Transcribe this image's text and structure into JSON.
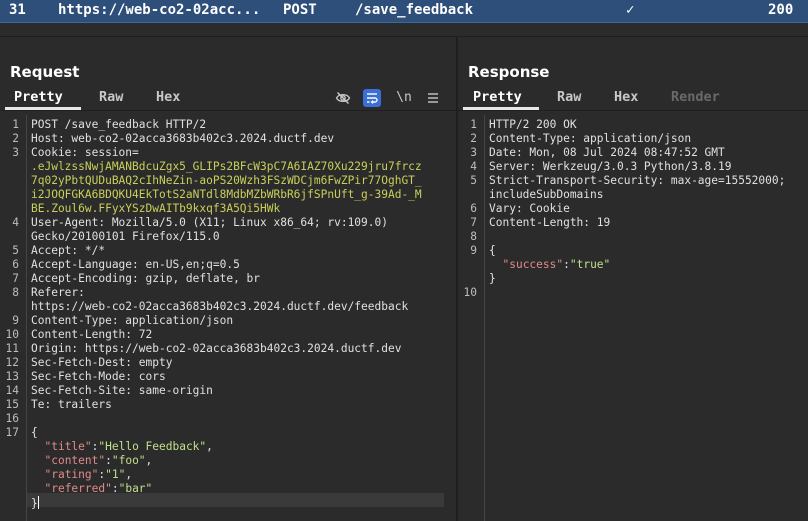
{
  "selected_row": {
    "id": "31",
    "url": "https://web-co2-02acc...",
    "method": "POST",
    "path": "/save_feedback",
    "check": "✓",
    "status": "200"
  },
  "request": {
    "title": "Request",
    "tabs": [
      "Pretty",
      "Raw",
      "Hex"
    ],
    "active_tab": "Pretty",
    "toolbar_icons": [
      "eye-slash-icon",
      "wrap-icon",
      "newline-icon",
      "menu-icon"
    ],
    "newline_label": "\\n",
    "lines": [
      {
        "n": "1",
        "text": "POST /save_feedback HTTP/2"
      },
      {
        "n": "2",
        "text": "Host: web-co2-02acca3683b402c3.2024.ductf.dev"
      },
      {
        "n": "3",
        "text": "Cookie: session="
      },
      {
        "n": "",
        "text": ".eJwlzssNwjAMANBdcuZgx5_GLIPs2BFcW3pC7A6IAZ70Xu229jru7frcz"
      },
      {
        "n": "",
        "text": "7q02yPbtQUDuBAQ2cIhNeZin-aoPS20Wzh3FSzWDCjm6FwZPir77OghGT_"
      },
      {
        "n": "",
        "text": "i2JOQFGKA6BDQKU4EkTotS2aNTdl8MdbMZbWRbR6jfSPnUft_g-39Ad-_M"
      },
      {
        "n": "",
        "text": "BE.Zoul6w.FFyxYSzDwAITb9kxqf3A5Qi5HWk"
      },
      {
        "n": "4",
        "text": "User-Agent: Mozilla/5.0 (X11; Linux x86_64; rv:109.0)"
      },
      {
        "n": "",
        "text": "Gecko/20100101 Firefox/115.0"
      },
      {
        "n": "5",
        "text": "Accept: */*"
      },
      {
        "n": "6",
        "text": "Accept-Language: en-US,en;q=0.5"
      },
      {
        "n": "7",
        "text": "Accept-Encoding: gzip, deflate, br"
      },
      {
        "n": "8",
        "text": "Referer:"
      },
      {
        "n": "",
        "text": "https://web-co2-02acca3683b402c3.2024.ductf.dev/feedback"
      },
      {
        "n": "9",
        "text": "Content-Type: application/json"
      },
      {
        "n": "10",
        "text": "Content-Length: 72"
      },
      {
        "n": "11",
        "text": "Origin: https://web-co2-02acca3683b402c3.2024.ductf.dev"
      },
      {
        "n": "12",
        "text": "Sec-Fetch-Dest: empty"
      },
      {
        "n": "13",
        "text": "Sec-Fetch-Mode: cors"
      },
      {
        "n": "14",
        "text": "Sec-Fetch-Site: same-origin"
      },
      {
        "n": "15",
        "text": "Te: trailers"
      },
      {
        "n": "16",
        "text": ""
      },
      {
        "n": "17",
        "text": "{"
      },
      {
        "n": "",
        "text": "  \"title\":\"Hello Feedback\","
      },
      {
        "n": "",
        "text": "  \"content\":\"foo\","
      },
      {
        "n": "",
        "text": "  \"rating\":\"1\","
      },
      {
        "n": "",
        "text": "  \"referred\":\"bar\""
      },
      {
        "n": "",
        "text": "}"
      }
    ]
  },
  "response": {
    "title": "Response",
    "tabs": [
      "Pretty",
      "Raw",
      "Hex",
      "Render"
    ],
    "active_tab": "Pretty",
    "lines": [
      {
        "n": "1",
        "text": "HTTP/2 200 OK"
      },
      {
        "n": "2",
        "text": "Content-Type: application/json"
      },
      {
        "n": "3",
        "text": "Date: Mon, 08 Jul 2024 08:47:52 GMT"
      },
      {
        "n": "4",
        "text": "Server: Werkzeug/3.0.3 Python/3.8.19"
      },
      {
        "n": "5",
        "text": "Strict-Transport-Security: max-age=15552000;"
      },
      {
        "n": "",
        "text": "includeSubDomains"
      },
      {
        "n": "6",
        "text": "Vary: Cookie"
      },
      {
        "n": "7",
        "text": "Content-Length: 19"
      },
      {
        "n": "8",
        "text": ""
      },
      {
        "n": "9",
        "text": "{"
      },
      {
        "n": "",
        "text": "  \"success\":\"true\""
      },
      {
        "n": "",
        "text": "}"
      },
      {
        "n": "10",
        "text": ""
      }
    ]
  }
}
